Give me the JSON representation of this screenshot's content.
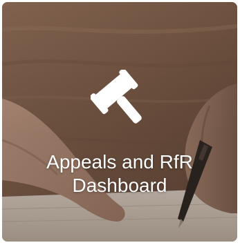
{
  "tile": {
    "title_line1": "Appeals and RfR",
    "title_line2": "Dashboard",
    "icon": "gavel-icon",
    "text_color": "#ffffff"
  }
}
